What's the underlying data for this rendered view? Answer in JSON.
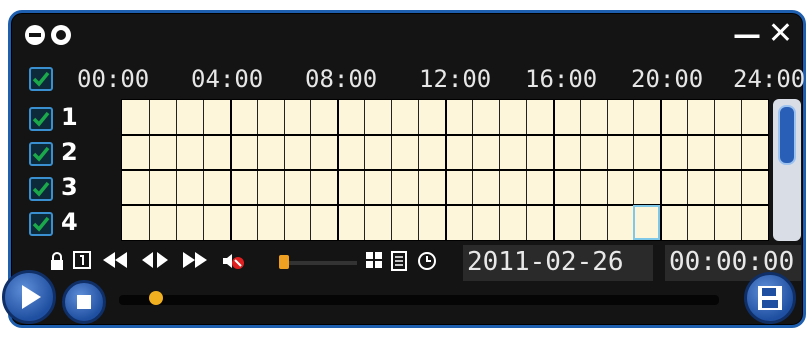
{
  "window": {
    "title_buttons": [
      "minus-circle-icon",
      "ring-circle-icon"
    ],
    "minimize_label": "—",
    "close_label": "✕"
  },
  "timeline": {
    "all_checked": true,
    "hours": [
      "00:00",
      "04:00",
      "08:00",
      "12:00",
      "16:00",
      "20:00",
      "24:00"
    ],
    "channels": [
      {
        "label": "1",
        "checked": true
      },
      {
        "label": "2",
        "checked": true
      },
      {
        "label": "3",
        "checked": true
      },
      {
        "label": "4",
        "checked": true
      }
    ],
    "columns": 24,
    "rows": 4,
    "selected_cell": {
      "column": 20,
      "row": 4
    }
  },
  "toolbar": {
    "icons": [
      "lock-icon",
      "one-frame-icon",
      "rewind-icon",
      "step-icon",
      "fast-forward-icon",
      "mute-icon",
      "volume-slider",
      "layout-icon",
      "list-icon",
      "clock-icon"
    ],
    "date": "2011-02-26",
    "time": "00:00:00"
  },
  "colors": {
    "accent": "#1f5fb0",
    "grid_bg": "#fdf6da",
    "check": "#1aa84a"
  }
}
